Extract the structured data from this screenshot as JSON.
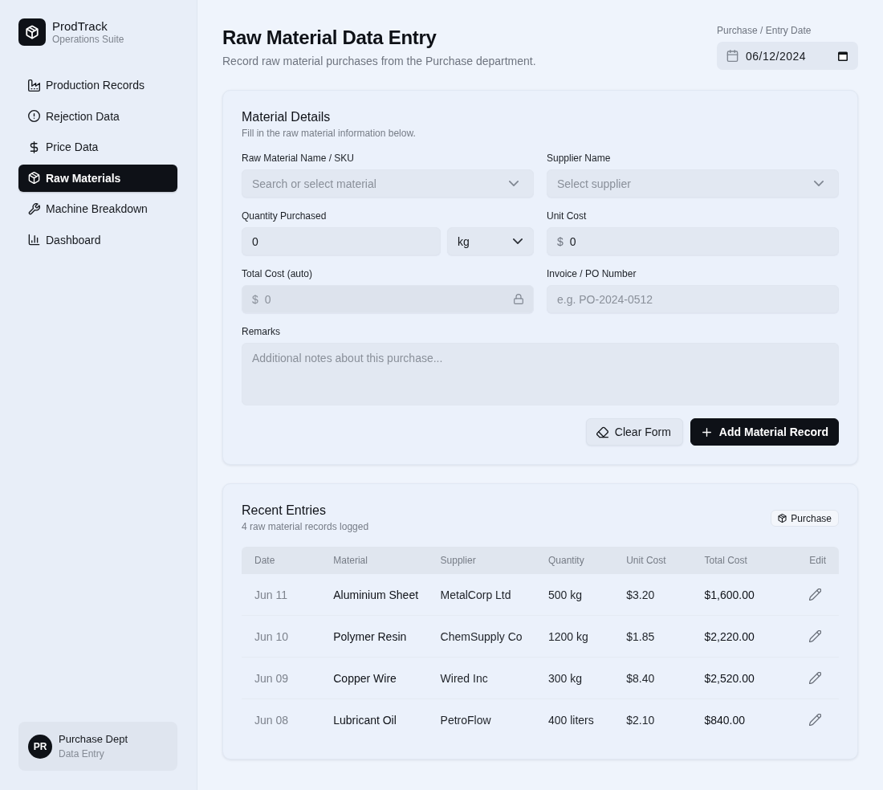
{
  "sidebar": {
    "brand": {
      "name": "ProdTrack",
      "tagline": "Operations Suite"
    },
    "nav": [
      {
        "label": "Production Records",
        "selected": false
      },
      {
        "label": "Rejection Data",
        "selected": false
      },
      {
        "label": "Price Data",
        "selected": false
      },
      {
        "label": "Raw Materials",
        "selected": true
      },
      {
        "label": "Machine Breakdown",
        "selected": false
      },
      {
        "label": "Dashboard",
        "selected": false
      }
    ],
    "user": {
      "initials": "PR",
      "name": "Purchase Dept",
      "role": "Data Entry"
    }
  },
  "header": {
    "title": "Raw Material Data Entry",
    "subtitle": "Record raw material purchases from the Purchase department.",
    "date": {
      "label": "Purchase / Entry Date",
      "value": "06/12/2024"
    }
  },
  "form": {
    "title": "Material Details",
    "subtitle": "Fill in the raw material information below.",
    "material": {
      "label": "Raw Material Name / SKU",
      "placeholder": "Search or select material"
    },
    "supplier": {
      "label": "Supplier Name",
      "placeholder": "Select supplier"
    },
    "quantity": {
      "label": "Quantity Purchased",
      "value": "0",
      "unit": "kg"
    },
    "unit_cost": {
      "label": "Unit Cost",
      "prefix": "$",
      "value": "0"
    },
    "total_cost": {
      "label": "Total Cost (auto)",
      "prefix": "$",
      "value": "0",
      "locked": true
    },
    "invoice": {
      "label": "Invoice / PO Number",
      "placeholder": "e.g. PO-2024-0512"
    },
    "remarks": {
      "label": "Remarks",
      "placeholder": "Additional notes about this purchase..."
    },
    "buttons": [
      {
        "label": "Clear Form",
        "kind": "secondary"
      },
      {
        "label": "Add Material Record",
        "kind": "primary"
      }
    ]
  },
  "recent": {
    "title": "Recent Entries",
    "subtitle": "4 raw material records logged",
    "badge": "Purchase",
    "columns": [
      "Date",
      "Material",
      "Supplier",
      "Quantity",
      "Unit Cost",
      "Total Cost",
      "Edit"
    ],
    "rows": [
      {
        "date": "Jun 11",
        "material": "Aluminium Sheet",
        "supplier": "MetalCorp Ltd",
        "quantity": "500 kg",
        "unit_cost": "$3.20",
        "total_cost": "$1,600.00"
      },
      {
        "date": "Jun 10",
        "material": "Polymer Resin",
        "supplier": "ChemSupply Co",
        "quantity": "1200 kg",
        "unit_cost": "$1.85",
        "total_cost": "$2,220.00"
      },
      {
        "date": "Jun 09",
        "material": "Copper Wire",
        "supplier": "Wired Inc",
        "quantity": "300 kg",
        "unit_cost": "$8.40",
        "total_cost": "$2,520.00"
      },
      {
        "date": "Jun 08",
        "material": "Lubricant Oil",
        "supplier": "PetroFlow",
        "quantity": "400 liters",
        "unit_cost": "$2.10",
        "total_cost": "$840.00"
      }
    ]
  }
}
